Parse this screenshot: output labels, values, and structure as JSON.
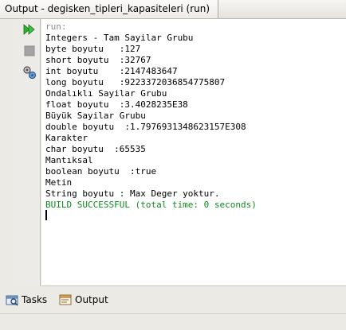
{
  "window": {
    "title": "Output - degisken_tipleri_kapasiteleri (run)"
  },
  "toolbar": {
    "rerun_icon": "double-play-icon",
    "stop_icon": "stop-square-icon",
    "options_icon": "settings-gears-icon"
  },
  "console": {
    "lines": [
      "run:",
      "Integers - Tam Sayilar Grubu",
      "byte boyutu   :127",
      "short boyutu  :32767",
      "int boyutu    :2147483647",
      "long boyutu   :9223372036854775807",
      "Ondalıklı Sayilar Grubu",
      "float boyutu  :3.4028235E38",
      "Büyük Sayilar Grubu",
      "double boyutu  :1.7976931348623157E308",
      "Karakter",
      "char boyutu  :65535",
      "Mantıksal",
      "boolean boyutu  :true",
      "Metin",
      "String boyutu : Max Deger yoktur.",
      "BUILD SUCCESSFUL (total time: 0 seconds)"
    ],
    "colors": {
      "muted": "#8a8a8a",
      "success": "#0c8a1e"
    }
  },
  "bottom_tabs": {
    "tasks_label": "Tasks",
    "tasks_icon": "tasks-icon",
    "output_label": "Output",
    "output_icon": "output-window-icon"
  }
}
